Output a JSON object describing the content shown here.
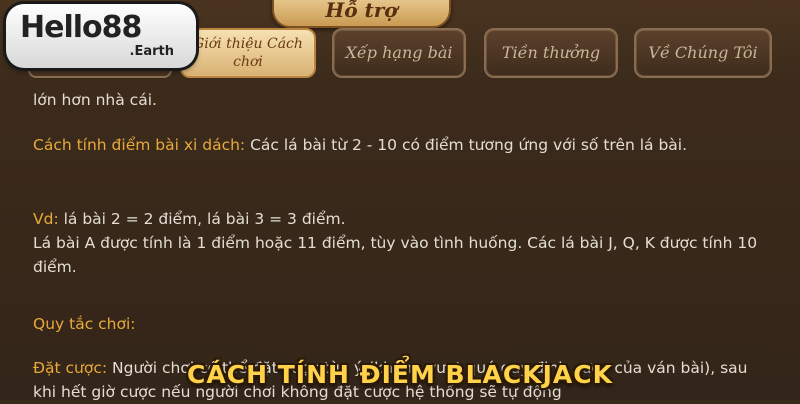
{
  "header": {
    "title": "Hỗ trợ"
  },
  "logo": {
    "name": "Hello88",
    "domain": ".Earth"
  },
  "tabs": [
    {
      "label": "Giới thiệu Cách chơi",
      "active": true
    },
    {
      "label": "Xếp hạng bài",
      "active": false
    },
    {
      "label": "Tiền thưởng",
      "active": false
    },
    {
      "label": "Về Chúng Tôi",
      "active": false
    }
  ],
  "content": {
    "line0": "lớn hơn nhà cái.",
    "p1_label": "Cách tính điểm bài xi dách:",
    "p1_text": " Các lá bài từ 2 - 10 có điểm tương ứng với số trên lá bài.",
    "p2_label": "Vd:",
    "p2_text": " lá bài 2 = 2 điểm, lá bài 3 = 3 điểm.",
    "p2_cont": " Lá bài A được tính là 1 điểm hoặc 11 điểm, tùy vào tình huống. Các lá bài J, Q, K được tính 10 điểm.",
    "p3_label": "Quy tắc chơi:",
    "p4_label": "Đặt cược:",
    "p4_text": " Người chơi có thể đặt cược tùy ý (không vượt quá quy định cược của ván bài), sau khi hết giờ cược nếu người chơi không đặt cược hệ thống sẽ tự động"
  },
  "caption": "CÁCH TÍNH ĐIỂM BLACKJACK",
  "colors": {
    "accent": "#e8a93a",
    "caption": "#ffd24a",
    "background": "#3c2b1b"
  }
}
